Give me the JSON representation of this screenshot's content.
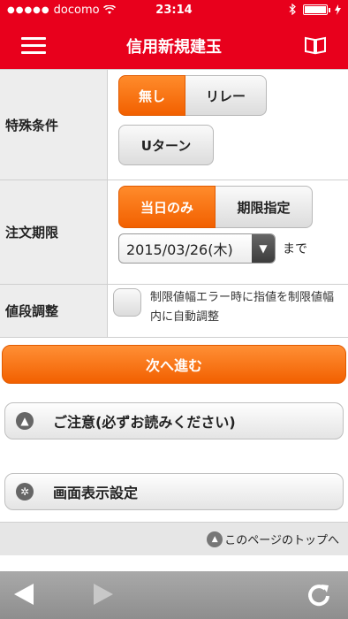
{
  "status_bar": {
    "carrier_dots": "●●●●●",
    "carrier": "docomo",
    "time": "23:14"
  },
  "nav": {
    "title": "信用新規建玉",
    "menu_icon": "hamburger-icon",
    "book_icon": "book-icon"
  },
  "special": {
    "label": "特殊条件",
    "options": [
      {
        "label": "無し",
        "selected": true
      },
      {
        "label": "リレー",
        "selected": false
      },
      {
        "label": "Uターン",
        "selected": false
      }
    ]
  },
  "period": {
    "label": "注文期限",
    "options": [
      {
        "label": "当日のみ",
        "selected": true
      },
      {
        "label": "期限指定",
        "selected": false
      }
    ],
    "date_value": "2015/03/26(木)",
    "date_suffix": "まで"
  },
  "price_adjust": {
    "label": "値段調整",
    "checkbox_text": "制限値幅エラー時に指値を制限値幅内に自動調整",
    "checked": false
  },
  "next_button": "次へ進む",
  "notice_button": "ご注意(必ずお読みください)",
  "display_settings_button": "画面表示設定",
  "page_top_link": "このページのトップへ",
  "colors": {
    "brand_red": "#e8001c",
    "accent_orange": "#f26000"
  }
}
